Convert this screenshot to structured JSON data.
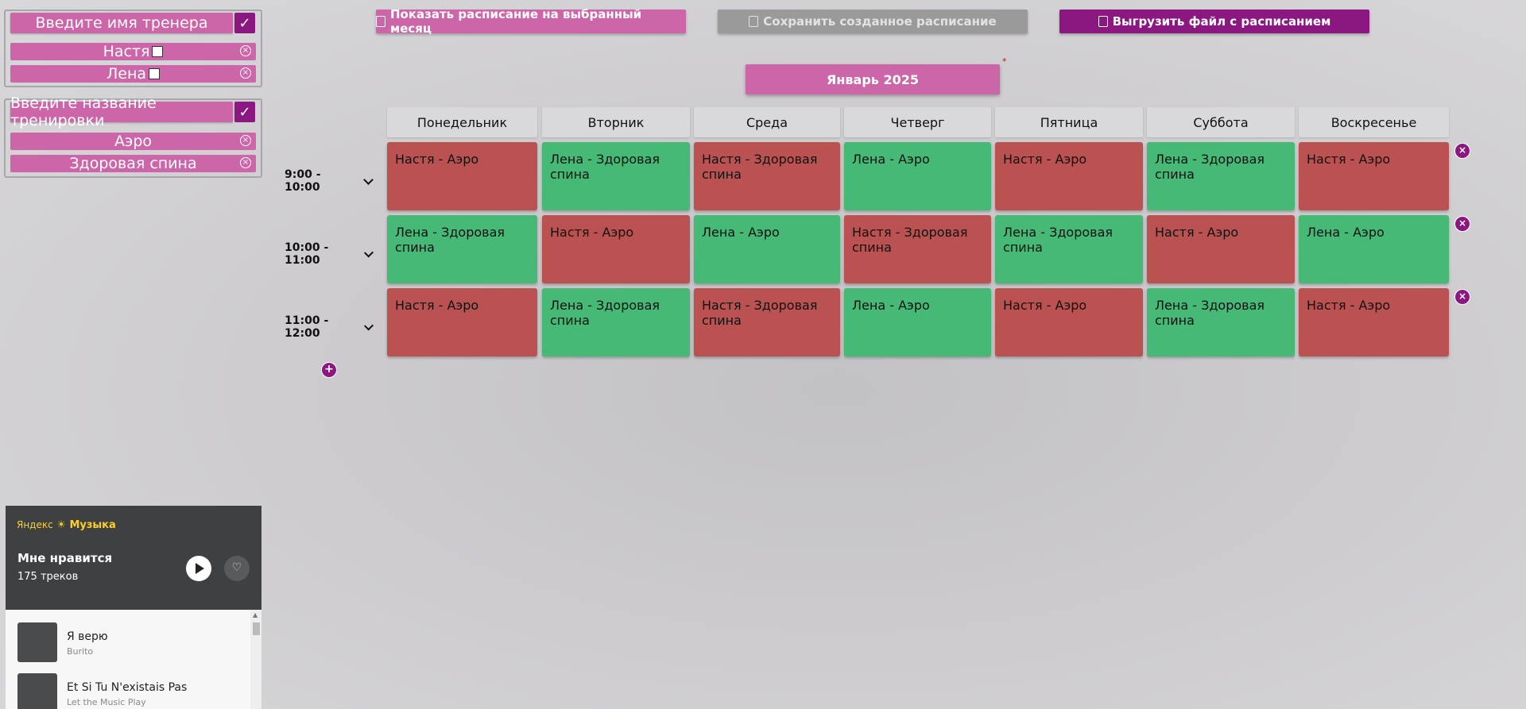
{
  "trainers": {
    "input_placeholder": "Введите имя тренера",
    "confirm": "✓",
    "items": [
      {
        "label": "Настя"
      },
      {
        "label": "Лена"
      }
    ]
  },
  "workouts": {
    "input_placeholder": "Введите название тренировки",
    "confirm": "✓",
    "items": [
      {
        "label": "Аэро"
      },
      {
        "label": "Здоровая спина"
      }
    ]
  },
  "toolbar": {
    "show_label": "Показать расписание на выбранный месяц",
    "save_label": "Сохранить созданное расписание",
    "export_label": "Выгрузить файл с расписанием"
  },
  "colors": {
    "accent_pink": "#cd66a8",
    "accent_purple": "#8b1781",
    "busy_red": "#bb5252",
    "free_green": "#46b977",
    "disabled_gray": "#9a9a9a"
  },
  "month": {
    "label": "Январь 2025",
    "required_mark": "*"
  },
  "schedule": {
    "days": [
      "Понедельник",
      "Вторник",
      "Среда",
      "Четверг",
      "Пятница",
      "Суббота",
      "Воскресенье"
    ],
    "rows": [
      {
        "time": "9:00 - 10:00",
        "cells": [
          {
            "text": "Настя - Аэро",
            "color": "red"
          },
          {
            "text": "Лена - Здоровая спина",
            "color": "green"
          },
          {
            "text": "Настя - Здоровая спина",
            "color": "red"
          },
          {
            "text": "Лена - Аэро",
            "color": "green"
          },
          {
            "text": "Настя - Аэро",
            "color": "red"
          },
          {
            "text": "Лена - Здоровая спина",
            "color": "green"
          },
          {
            "text": "Настя - Аэро",
            "color": "red"
          }
        ]
      },
      {
        "time": "10:00 - 11:00",
        "cells": [
          {
            "text": "Лена - Здоровая спина",
            "color": "green"
          },
          {
            "text": "Настя - Аэро",
            "color": "red"
          },
          {
            "text": "Лена - Аэро",
            "color": "green"
          },
          {
            "text": "Настя - Здоровая спина",
            "color": "red"
          },
          {
            "text": "Лена - Здоровая спина",
            "color": "green"
          },
          {
            "text": "Настя - Аэро",
            "color": "red"
          },
          {
            "text": "Лена - Аэро",
            "color": "green"
          }
        ]
      },
      {
        "time": "11:00 - 12:00",
        "cells": [
          {
            "text": "Настя - Аэро",
            "color": "red"
          },
          {
            "text": "Лена - Здоровая спина",
            "color": "green"
          },
          {
            "text": "Настя - Здоровая спина",
            "color": "red"
          },
          {
            "text": "Лена - Аэро",
            "color": "green"
          },
          {
            "text": "Настя - Аэро",
            "color": "red"
          },
          {
            "text": "Лена - Здоровая спина",
            "color": "green"
          },
          {
            "text": "Настя - Аэро",
            "color": "red"
          }
        ]
      }
    ]
  },
  "music": {
    "brand_left": "Яндекс",
    "brand_right": "Музыка",
    "playlist_title": "Мне нравится",
    "track_count": "175 треков",
    "tracks": [
      {
        "title": "Я верю",
        "artist": "Burito"
      },
      {
        "title": "Et Si Tu N'existais Pas",
        "artist": "Let the Music Play"
      }
    ]
  }
}
